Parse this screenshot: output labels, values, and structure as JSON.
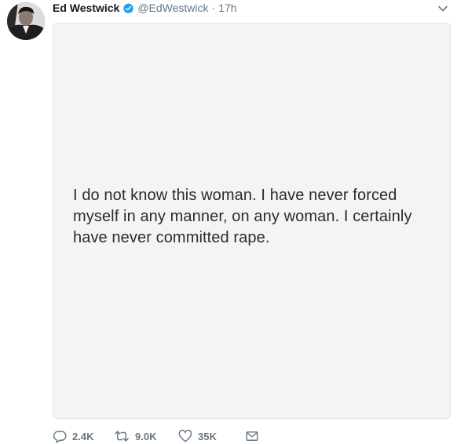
{
  "tweet": {
    "author_name": "Ed Westwick",
    "handle": "@EdWestwick",
    "separator": "·",
    "time": "17h",
    "media_text": "I do not know this woman. I have never forced myself in any manner, on any woman. I certainly have never committed rape."
  },
  "actions": {
    "reply_count": "2.4K",
    "retweet_count": "9.0K",
    "like_count": "35K"
  },
  "icons": {
    "verified": "verified-badge-icon",
    "caret": "chevron-down-icon",
    "reply": "reply-icon",
    "retweet": "retweet-icon",
    "like": "heart-icon",
    "dm": "envelope-icon"
  },
  "colors": {
    "verified_blue": "#1da1f2",
    "secondary_text": "#657786",
    "primary_text": "#14171a",
    "media_background": "#f4f4f2"
  }
}
